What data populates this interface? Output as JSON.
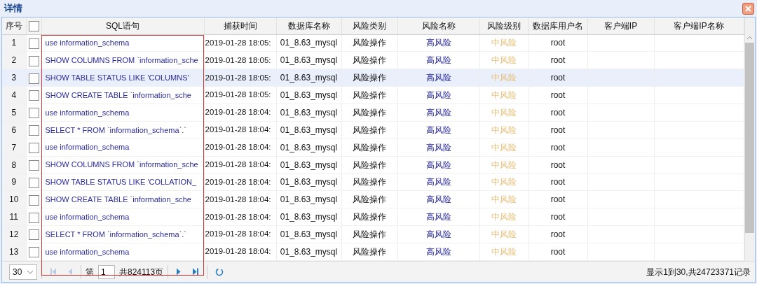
{
  "window": {
    "title": "详情"
  },
  "table": {
    "columns": [
      "序号",
      "SQL语句",
      "捕获时间",
      "数据库名称",
      "风险类别",
      "风险名称",
      "风险级别",
      "数据库用户名",
      "客户端IP",
      "客户端IP名称"
    ],
    "header_checked": false,
    "rows": [
      {
        "no": "1",
        "checked": false,
        "selected": false,
        "sql": "use information_schema",
        "time": "2019-01-28 18:05:",
        "db": "01_8.63_mysql",
        "risk_type": "风险操作",
        "risk_name": "高风险",
        "risk_level": "中风险",
        "user": "root"
      },
      {
        "no": "2",
        "checked": false,
        "selected": false,
        "sql": "SHOW COLUMNS FROM `information_sche",
        "time": "2019-01-28 18:05:",
        "db": "01_8.63_mysql",
        "risk_type": "风险操作",
        "risk_name": "高风险",
        "risk_level": "中风险",
        "user": "root"
      },
      {
        "no": "3",
        "checked": false,
        "selected": true,
        "sql": "SHOW TABLE STATUS LIKE 'COLUMNS'",
        "time": "2019-01-28 18:05:",
        "db": "01_8.63_mysql",
        "risk_type": "风险操作",
        "risk_name": "高风险",
        "risk_level": "中风险",
        "user": "root"
      },
      {
        "no": "4",
        "checked": false,
        "selected": false,
        "sql": "SHOW CREATE TABLE `information_sche",
        "time": "2019-01-28 18:05:",
        "db": "01_8.63_mysql",
        "risk_type": "风险操作",
        "risk_name": "高风险",
        "risk_level": "中风险",
        "user": "root"
      },
      {
        "no": "5",
        "checked": false,
        "selected": false,
        "sql": "use information_schema",
        "time": "2019-01-28 18:04:",
        "db": "01_8.63_mysql",
        "risk_type": "风险操作",
        "risk_name": "高风险",
        "risk_level": "中风险",
        "user": "root"
      },
      {
        "no": "6",
        "checked": false,
        "selected": false,
        "sql": "SELECT * FROM `information_schema`.`",
        "time": "2019-01-28 18:04:",
        "db": "01_8.63_mysql",
        "risk_type": "风险操作",
        "risk_name": "高风险",
        "risk_level": "中风险",
        "user": "root"
      },
      {
        "no": "7",
        "checked": false,
        "selected": false,
        "sql": "use information_schema",
        "time": "2019-01-28 18:04:",
        "db": "01_8.63_mysql",
        "risk_type": "风险操作",
        "risk_name": "高风险",
        "risk_level": "中风险",
        "user": "root"
      },
      {
        "no": "8",
        "checked": false,
        "selected": false,
        "sql": "SHOW COLUMNS FROM `information_sche",
        "time": "2019-01-28 18:04:",
        "db": "01_8.63_mysql",
        "risk_type": "风险操作",
        "risk_name": "高风险",
        "risk_level": "中风险",
        "user": "root"
      },
      {
        "no": "9",
        "checked": false,
        "selected": false,
        "sql": "SHOW TABLE STATUS LIKE 'COLLATION_",
        "time": "2019-01-28 18:04:",
        "db": "01_8.63_mysql",
        "risk_type": "风险操作",
        "risk_name": "高风险",
        "risk_level": "中风险",
        "user": "root"
      },
      {
        "no": "10",
        "checked": false,
        "selected": false,
        "sql": "SHOW CREATE TABLE `information_sche",
        "time": "2019-01-28 18:04:",
        "db": "01_8.63_mysql",
        "risk_type": "风险操作",
        "risk_name": "高风险",
        "risk_level": "中风险",
        "user": "root"
      },
      {
        "no": "11",
        "checked": false,
        "selected": false,
        "sql": "use information_schema",
        "time": "2019-01-28 18:04:",
        "db": "01_8.63_mysql",
        "risk_type": "风险操作",
        "risk_name": "高风险",
        "risk_level": "中风险",
        "user": "root"
      },
      {
        "no": "12",
        "checked": false,
        "selected": false,
        "sql": "SELECT * FROM `information_schema`.`",
        "time": "2019-01-28 18:04:",
        "db": "01_8.63_mysql",
        "risk_type": "风险操作",
        "risk_name": "高风险",
        "risk_level": "中风险",
        "user": "root"
      },
      {
        "no": "13",
        "checked": false,
        "selected": false,
        "sql": "use information_schema",
        "time": "2019-01-28 18:04:",
        "db": "01_8.63_mysql",
        "risk_type": "风险操作",
        "risk_name": "高风险",
        "risk_level": "中风险",
        "user": "root"
      }
    ]
  },
  "pager": {
    "page_size": "30",
    "page_label": "第",
    "page": "1",
    "total_pages": "共824113页",
    "summary": "显示1到30,共24723371记录"
  }
}
